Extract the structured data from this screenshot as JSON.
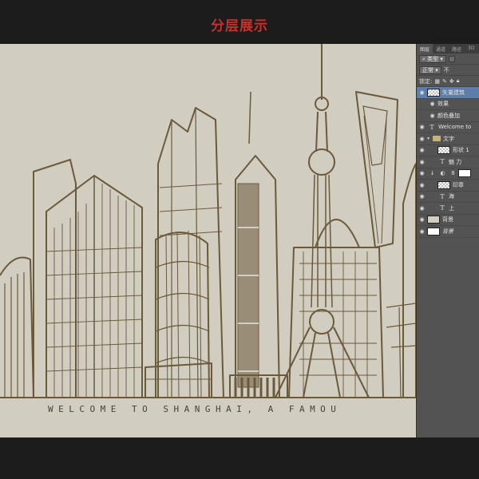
{
  "caption": "分层展示",
  "canvas": {
    "tagline": "WELCOME TO SHANGHAI, A FAMOU",
    "background_color": "#d2cdc1",
    "line_color": "#6b5a3a"
  },
  "layers_panel": {
    "tabs": [
      {
        "label": "图层",
        "active": true
      },
      {
        "label": "通道",
        "active": false
      },
      {
        "label": "路径",
        "active": false
      },
      {
        "label": "3D",
        "active": false
      }
    ],
    "filter_label": "类型",
    "blend_mode": "正常",
    "opacity_label": "不",
    "lock_label": "锁定:",
    "layers": [
      {
        "name": "矢量建筑",
        "kind": "smart",
        "selected": true
      },
      {
        "name": "效果",
        "kind": "effect"
      },
      {
        "name": "颜色叠加",
        "kind": "effect"
      },
      {
        "name": "Welcome to",
        "kind": "text"
      },
      {
        "name": "文字",
        "kind": "group"
      },
      {
        "name": "形状 1",
        "kind": "shape"
      },
      {
        "name": "魅 力",
        "kind": "text"
      },
      {
        "name": "",
        "kind": "adjust"
      },
      {
        "name": "印章",
        "kind": "shape"
      },
      {
        "name": "海",
        "kind": "text"
      },
      {
        "name": "上",
        "kind": "text"
      },
      {
        "name": "背景",
        "kind": "fill"
      },
      {
        "name": "背景",
        "kind": "white"
      }
    ]
  }
}
